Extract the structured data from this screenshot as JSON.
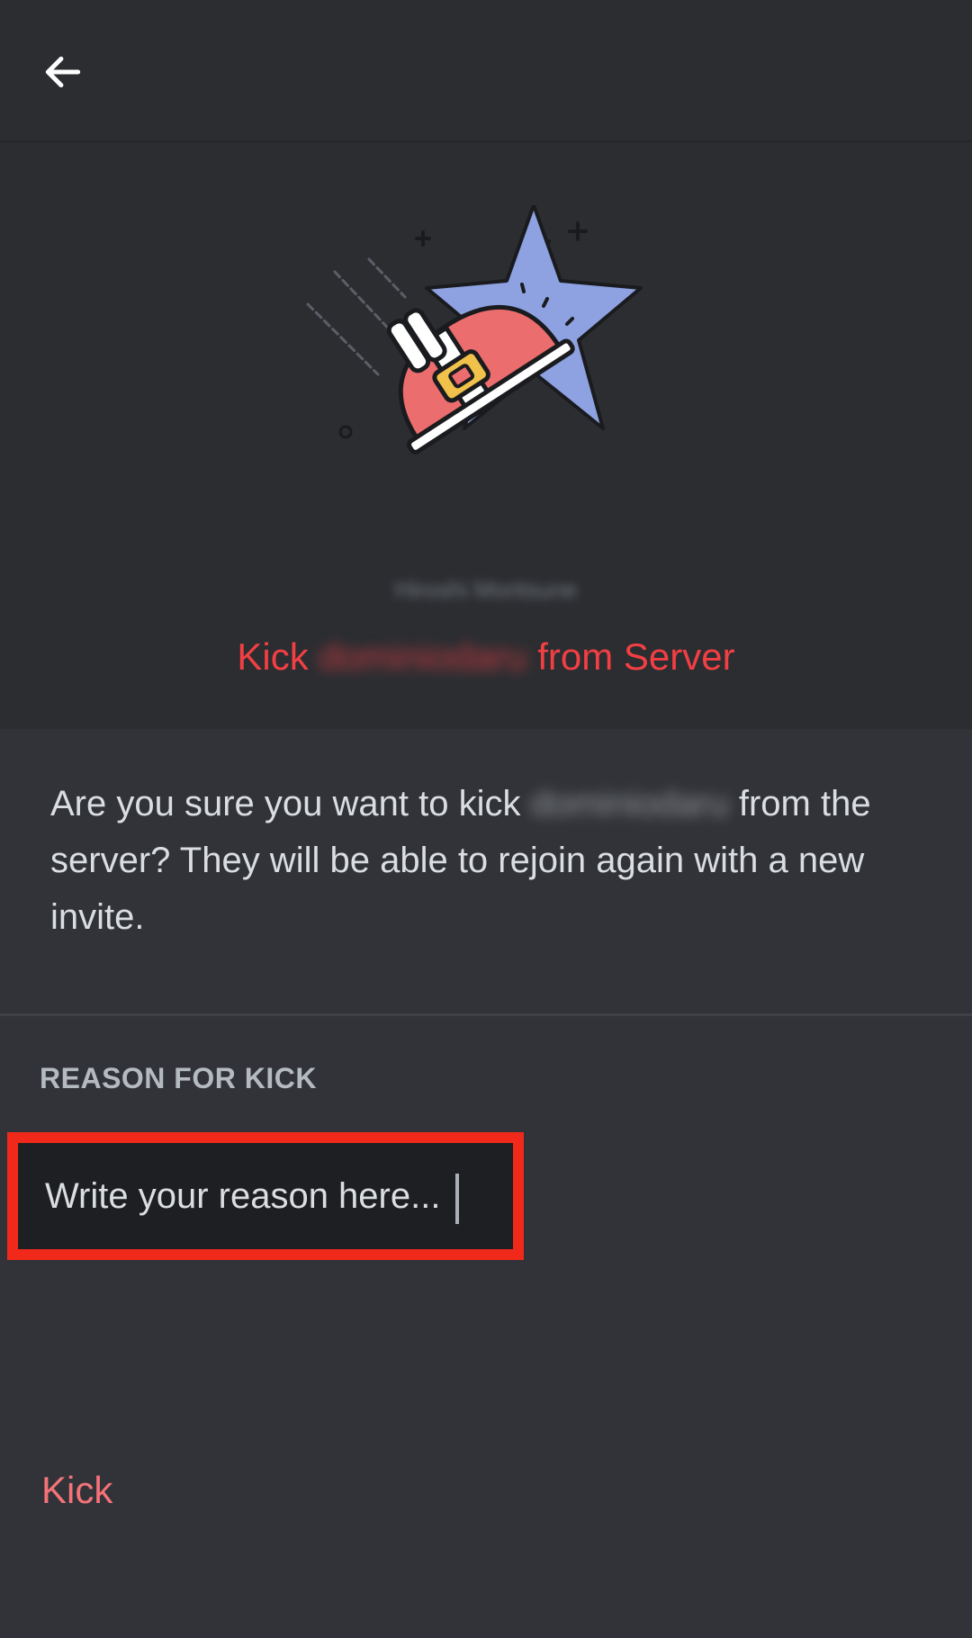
{
  "header": {
    "back_icon": "arrow-left-icon"
  },
  "hero": {
    "server_name": "Hiroshi Moritsune",
    "title_prefix": "Kick",
    "title_username": "dominiodaru",
    "title_suffix": "from Server",
    "illustration": "santa-hat-kick-illustration"
  },
  "confirm": {
    "line_prefix": "Are you sure you want to kick",
    "username": "dominiodaru",
    "line_suffix": "from the server? They will be able to rejoin again with a new invite."
  },
  "reason": {
    "label": "REASON FOR KICK",
    "placeholder": "Write your reason here...",
    "value": ""
  },
  "actions": {
    "kick_label": "Kick"
  },
  "colors": {
    "background": "#313338",
    "hero_background": "#2b2d31",
    "danger": "#f23f43",
    "highlight_border": "#f0291a"
  }
}
